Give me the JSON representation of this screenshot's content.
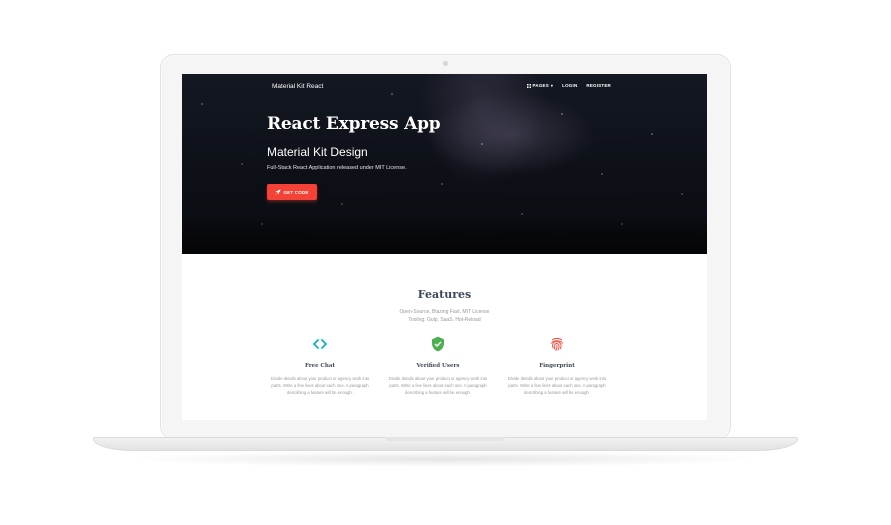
{
  "navbar": {
    "brand": "Material Kit React",
    "pages_label": "PAGES",
    "login_label": "LOGIN",
    "register_label": "REGISTER"
  },
  "hero": {
    "title": "React Express App",
    "subtitle": "Material Kit Design",
    "description": "Full-Stack React Application released under MIT License.",
    "button_label": "GET CODE",
    "button_color": "#f44336"
  },
  "features": {
    "title": "Features",
    "desc_line1": "Open-Source, Blazing Fast, MIT License",
    "desc_line2": "Tooling: Gulp, SaaS, Hot-Reload",
    "items": [
      {
        "title": "Free Chat",
        "icon": "code-icon",
        "color": "#00acc1",
        "desc_line1": "Divide details about your product or agency work into",
        "desc_line2": "parts. Write a few lines about each one. A paragraph",
        "desc_line3": "describing a feature will be enough."
      },
      {
        "title": "Verified Users",
        "icon": "verified-shield-icon",
        "color": "#4caf50",
        "desc_line1": "Divide details about your product or agency work into",
        "desc_line2": "parts. Write a few lines about each one. A paragraph",
        "desc_line3": "describing a feature will be enough."
      },
      {
        "title": "Fingerprint",
        "icon": "fingerprint-icon",
        "color": "#f44336",
        "desc_line1": "Divide details about your product or agency work into",
        "desc_line2": "parts. Write a few lines about each one. A paragraph",
        "desc_line3": "describing a feature will be enough."
      }
    ]
  }
}
